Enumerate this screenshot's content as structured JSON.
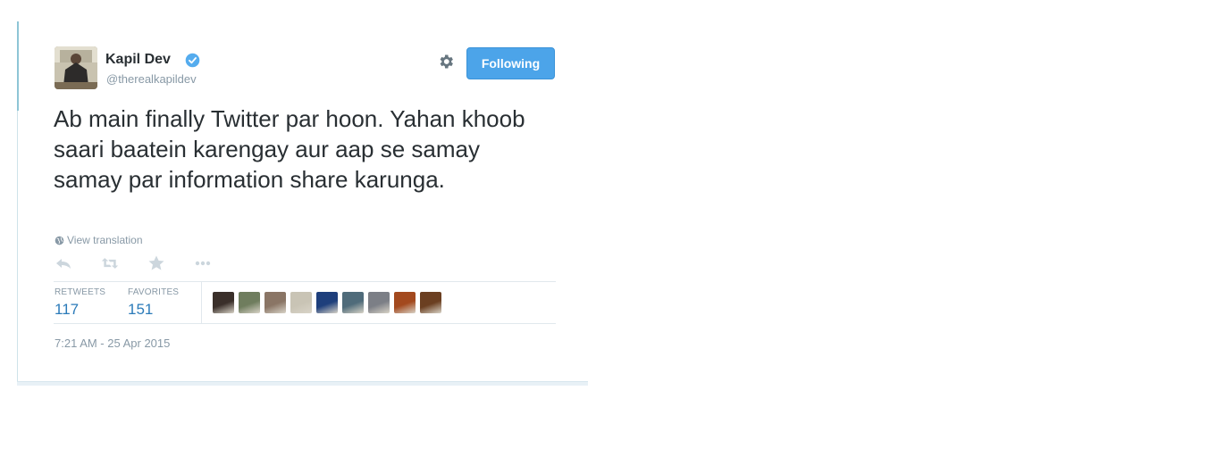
{
  "tweet": {
    "author_name": "Kapil Dev",
    "author_handle": "@therealkapildev",
    "verified_icon": "verified-badge-icon",
    "follow_label": "Following",
    "text": "Ab main finally Twitter par hoon. Yahan khoob saari baatein karengay aur aap se samay samay par information share karunga.",
    "translate_label": "View translation",
    "actions": [
      "reply-icon",
      "retweet-icon",
      "favorite-icon",
      "more-icon"
    ],
    "stats": {
      "retweets_label": "RETWEETS",
      "retweets_value": "117",
      "favorites_label": "FAVORITES",
      "favorites_value": "151"
    },
    "favoriter_avatar_colors": [
      "#3a2f2a",
      "#6f7d5e",
      "#8a7565",
      "#c9c4b5",
      "#1e3f7c",
      "#4f6b7a",
      "#7c7f86",
      "#a3491e",
      "#6b3f21"
    ],
    "timestamp": "7:21 AM - 25 Apr 2015"
  },
  "colors": {
    "accent": "#4ca4e9",
    "link": "#2b7bb9",
    "muted": "#8899a6",
    "text": "#292f33"
  }
}
